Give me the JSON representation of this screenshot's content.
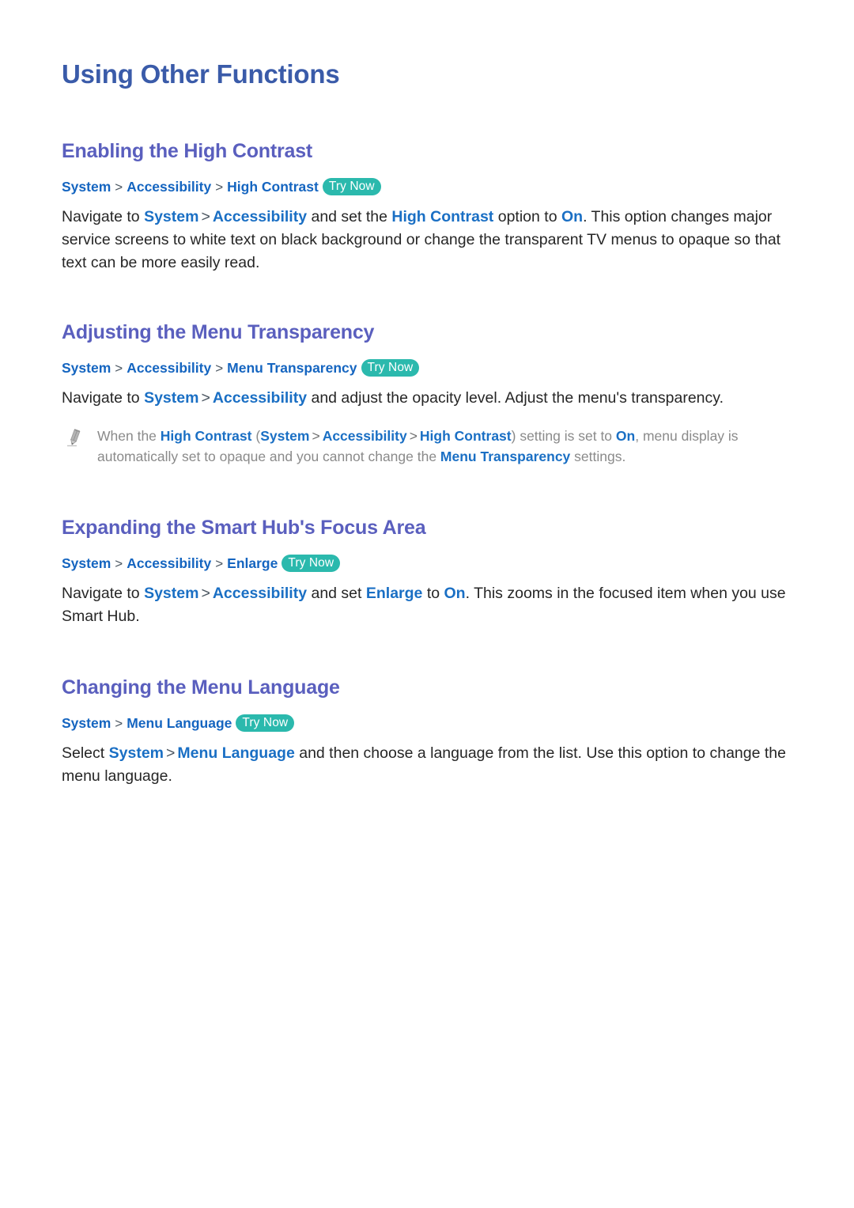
{
  "page": {
    "title": "Using Other Functions"
  },
  "sections": [
    {
      "heading": "Enabling the High Contrast",
      "breadcrumb": {
        "crumbs": [
          "System",
          "Accessibility",
          "High Contrast"
        ],
        "separator": ">",
        "badge": "Try Now"
      },
      "paragraph": {
        "p1": "Navigate to ",
        "hl1": "System",
        "sep1": ">",
        "hl2": "Accessibility",
        "p2": " and set the ",
        "hl3": "High Contrast",
        "p3": " option to ",
        "hl4": "On",
        "p4": ". This option changes major service screens to white text on black background or change the transparent TV menus to opaque so that text can be more easily read."
      }
    },
    {
      "heading": "Adjusting the Menu Transparency",
      "breadcrumb": {
        "crumbs": [
          "System",
          "Accessibility",
          "Menu Transparency"
        ],
        "separator": ">",
        "badge": "Try Now"
      },
      "paragraph": {
        "p1": "Navigate to ",
        "hl1": "System",
        "sep1": ">",
        "hl2": "Accessibility",
        "p2": " and adjust the opacity level. Adjust the menu's transparency."
      },
      "note": {
        "icon": "pencil-icon",
        "n1": "When the ",
        "hl1": "High Contrast",
        "open_paren": " (",
        "hl2": "System",
        "sep1": ">",
        "hl3": "Accessibility",
        "sep2": ">",
        "hl4": "High Contrast",
        "close_paren": ")",
        "n2": " setting is set to ",
        "hl5": "On",
        "n3": ", menu display is automatically set to opaque and you cannot change the ",
        "hl6": "Menu Transparency",
        "n4": " settings."
      }
    },
    {
      "heading": "Expanding the Smart Hub's Focus Area",
      "breadcrumb": {
        "crumbs": [
          "System",
          "Accessibility",
          "Enlarge"
        ],
        "separator": ">",
        "badge": "Try Now"
      },
      "paragraph": {
        "p1": "Navigate to ",
        "hl1": "System",
        "sep1": ">",
        "hl2": "Accessibility",
        "p2": " and set ",
        "hl3": "Enlarge",
        "p3": " to ",
        "hl4": "On",
        "p4": ". This zooms in the focused item when you use Smart Hub."
      }
    },
    {
      "heading": "Changing the Menu Language",
      "breadcrumb": {
        "crumbs": [
          "System",
          "Menu Language"
        ],
        "separator": ">",
        "badge": "Try Now"
      },
      "paragraph": {
        "p1": "Select ",
        "hl1": "System",
        "sep1": ">",
        "hl2": "Menu Language",
        "p2": " and then choose a language from the list. Use this option to change the menu language."
      }
    }
  ],
  "colors": {
    "page_title": "#3a5ba9",
    "section_heading": "#5a5fbe",
    "breadcrumb_link": "#1565c0",
    "inline_highlight": "#1a6fc4",
    "badge_background": "#2bb9ad",
    "badge_text": "#ffffff",
    "body_text": "#262626",
    "note_text": "#8a8a8a"
  }
}
